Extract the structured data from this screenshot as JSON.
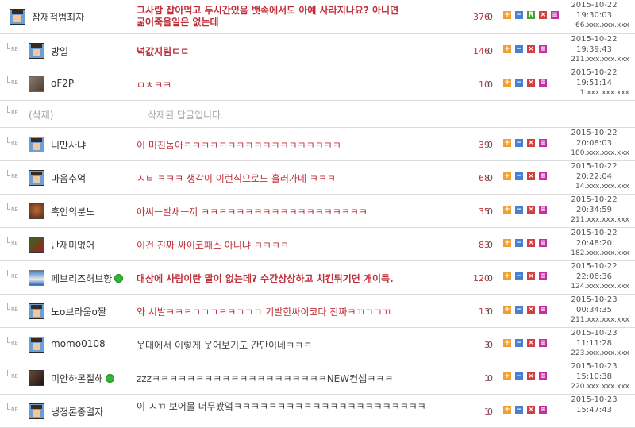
{
  "re_label": "RE",
  "deleted_row": {
    "nick": "(삭제)",
    "text": "삭제된 답글입니다."
  },
  "buttons": {
    "plus": "+",
    "minus": "−",
    "report": "R",
    "close": "×",
    "mail": "≡"
  },
  "comments": [
    {
      "nick": "잠재적범죄자",
      "avatar": "pixel-avatar",
      "text_line1": "그사람 잡아먹고 두시간있음 뱃속에서도 아예 사라지나요? 아니면",
      "text_line2": "굶어죽을일은 없는데",
      "count": "376",
      "zero": "0",
      "date": "2015-10-22",
      "time": "19:30:03",
      "ip": "66.xxx.xxx.xxx"
    },
    {
      "nick": "방일",
      "avatar": "pixel-avatar",
      "text": "넉값지림ㄷㄷ",
      "count": "146",
      "zero": "0",
      "date": "2015-10-22",
      "time": "19:39:43",
      "ip": "211.xxx.xxx.xxx"
    },
    {
      "nick": "oF2P",
      "avatar": "photo-avatar",
      "text": "ㅁㅊㅋㅋ",
      "count": "10",
      "zero": "0",
      "date": "2015-10-22",
      "time": "19:51:14",
      "ip": "1.xxx.xxx.xxx"
    },
    {
      "nick": "니만사냐",
      "avatar": "pixel-avatar",
      "text": "이 미친놈아ㅋㅋㅋㅋㅋㅋㅋㅋㅋㅋㅋㅋㅋㅋㅋㅋㅋㅋ",
      "count": "39",
      "zero": "0",
      "date": "2015-10-22",
      "time": "20:08:03",
      "ip": "180.xxx.xxx.xxx"
    },
    {
      "nick": "마음추억",
      "avatar": "pixel-avatar",
      "text": "ㅅㅂ ㅋㅋㅋ 생각이 이런식으로도 흘러가네 ㅋㅋㅋ",
      "count": "68",
      "zero": "0",
      "date": "2015-10-22",
      "time": "20:22:04",
      "ip": "14.xxx.xxx.xxx"
    },
    {
      "nick": "흑인의분노",
      "avatar": "photo-avatar",
      "text": "아씨ㅡ발새ㅡ끼 ㅋㅋㅋㅋㅋㅋㅋㅋㅋㅋㅋㅋㅋㅋㅋㅋㅋㅋㅋ",
      "count": "35",
      "zero": "0",
      "date": "2015-10-22",
      "time": "20:34:59",
      "ip": "211.xxx.xxx.xxx"
    },
    {
      "nick": "난재미없어",
      "avatar": "photo-avatar",
      "text": "이건 진짜 싸이코패스 아니냐 ㅋㅋㅋㅋ",
      "count": "83",
      "zero": "0",
      "date": "2015-10-22",
      "time": "20:48:20",
      "ip": "182.xxx.xxx.xxx"
    },
    {
      "nick": "페브리즈허브향",
      "avatar": "photo-avatar",
      "text": "대상에 사람이란 말이 없는데? 수간상상하고 치킨튀기면 개이득.",
      "count": "120",
      "zero": "0",
      "date": "2015-10-22",
      "time": "22:06:36",
      "ip": "124.xxx.xxx.xxx"
    },
    {
      "nick": "노o브라움o짤",
      "avatar": "pixel-avatar",
      "text": "와 시발ㅋㅋㅋㄱㄱㄱㅋㅋㄱㄱㄱ 기발한싸이코다 진짜ㅋㄲㄱㄱㄲ",
      "count": "13",
      "zero": "0",
      "date": "2015-10-23",
      "time": "00:34:35",
      "ip": "211.xxx.xxx.xxx"
    },
    {
      "nick": "momo0108",
      "avatar": "pixel-avatar",
      "text": "웃대에서 이렇게 웃어보기도 간만이네ㅋㅋㅋ",
      "count": "3",
      "zero": "0",
      "date": "2015-10-23",
      "time": "11:11:28",
      "ip": "223.xxx.xxx.xxx"
    },
    {
      "nick": "미안하몬절해",
      "avatar": "photo-avatar",
      "text": "zzzㅋㅋㅋㅋㅋㅋㅋㅋㅋㅋㅋㅋㅋㅋㅋㅋㅋㅋㅋㅋNEW컨셉ㅋㅋㅋ",
      "count": "1",
      "zero": "0",
      "date": "2015-10-23",
      "time": "15:10:38",
      "ip": "220.xxx.xxx.xxx"
    },
    {
      "nick": "냉정론종결자",
      "avatar": "pixel-avatar",
      "text": "이 ㅅㄲ 보어물 너무봤엌ㅋㅋㅋㅋㅋㅋㅋㅋㅋㅋㅋㅋㅋㅋㅋㅋㅋㅋㅋㅋㅋㅋ",
      "count": "1",
      "zero": "0",
      "date": "2015-10-23",
      "time": "15:47:43",
      "ip": ""
    }
  ]
}
